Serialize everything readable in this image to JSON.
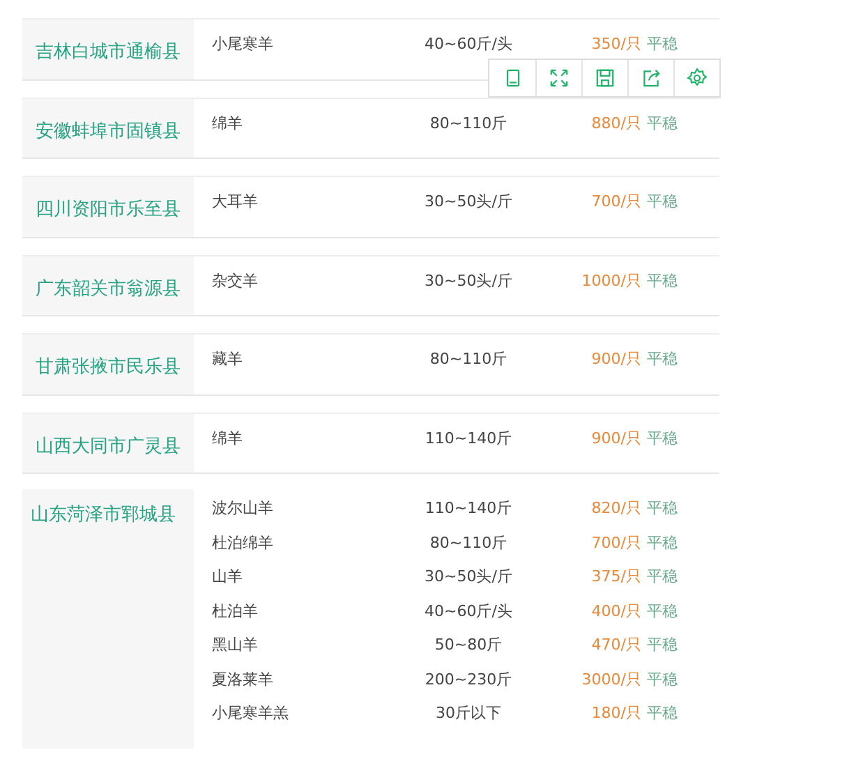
{
  "groups": [
    {
      "location": "吉林白城市通榆县",
      "items": [
        {
          "name": "小尾寒羊",
          "spec": "40~60斤/头",
          "price": "350/只",
          "trend": "平稳"
        }
      ]
    },
    {
      "location": "安徽蚌埠市固镇县",
      "items": [
        {
          "name": "绵羊",
          "spec": "80~110斤",
          "price": "880/只",
          "trend": "平稳"
        }
      ]
    },
    {
      "location": "四川资阳市乐至县",
      "items": [
        {
          "name": "大耳羊",
          "spec": "30~50头/斤",
          "price": "700/只",
          "trend": "平稳"
        }
      ]
    },
    {
      "location": "广东韶关市翁源县",
      "items": [
        {
          "name": "杂交羊",
          "spec": "30~50头/斤",
          "price": "1000/只",
          "trend": "平稳"
        }
      ]
    },
    {
      "location": "甘肃张掖市民乐县",
      "items": [
        {
          "name": "藏羊",
          "spec": "80~110斤",
          "price": "900/只",
          "trend": "平稳"
        }
      ]
    },
    {
      "location": "山西大同市广灵县",
      "items": [
        {
          "name": "绵羊",
          "spec": "110~140斤",
          "price": "900/只",
          "trend": "平稳"
        }
      ]
    },
    {
      "location": "山东菏泽市郓城县",
      "items": [
        {
          "name": "波尔山羊",
          "spec": "110~140斤",
          "price": "820/只",
          "trend": "平稳"
        },
        {
          "name": "杜泊绵羊",
          "spec": "80~110斤",
          "price": "700/只",
          "trend": "平稳"
        },
        {
          "name": "山羊",
          "spec": "30~50头/斤",
          "price": "375/只",
          "trend": "平稳"
        },
        {
          "name": "杜泊羊",
          "spec": "40~60斤/头",
          "price": "400/只",
          "trend": "平稳"
        },
        {
          "name": "黑山羊",
          "spec": "50~80斤",
          "price": "470/只",
          "trend": "平稳"
        },
        {
          "name": "夏洛莱羊",
          "spec": "200~230斤",
          "price": "3000/只",
          "trend": "平稳"
        },
        {
          "name": "小尾寒羊羔",
          "spec": "30斤以下",
          "price": "180/只",
          "trend": "平稳"
        }
      ]
    }
  ]
}
